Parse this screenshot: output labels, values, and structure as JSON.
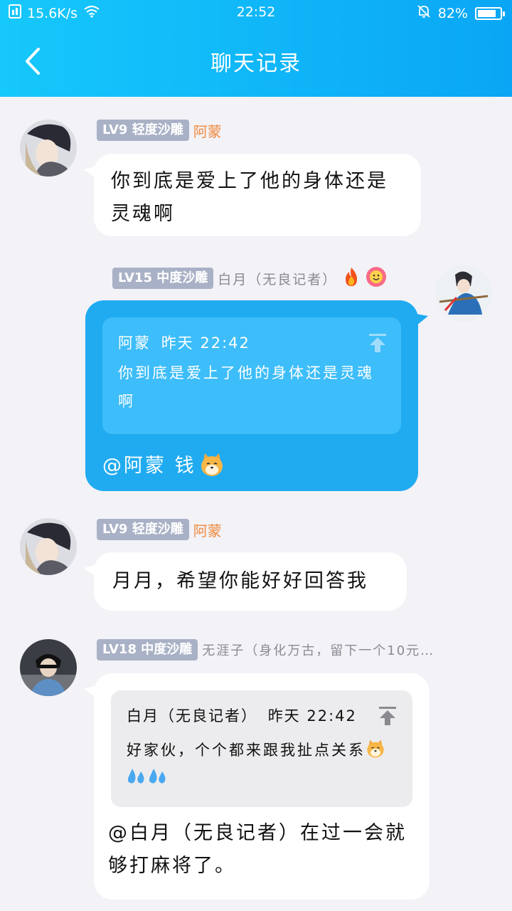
{
  "status_bar": {
    "net_speed": "15.6K/s",
    "time": "22:52",
    "battery": "82%",
    "battery_level": 0.82
  },
  "header": {
    "title": "聊天记录"
  },
  "messages": [
    {
      "level": "LV9 轻度沙雕",
      "sender": "阿蒙",
      "text": "你到底是爱上了他的身体还是灵魂啊"
    },
    {
      "level": "LV15 中度沙雕",
      "sender": "白月（无良记者）",
      "quote": {
        "author": "阿蒙",
        "time": "昨天 22:42",
        "text": "你到底是爱上了他的身体还是灵魂啊"
      },
      "text": "@阿蒙 钱"
    },
    {
      "level": "LV9 轻度沙雕",
      "sender": "阿蒙",
      "text": "月月，希望你能好好回答我"
    },
    {
      "level": "LV18 中度沙雕",
      "sender": "无涯子（身化万古，留下一个10元…",
      "quote": {
        "author": "白月（无良记者）",
        "time": "昨天 22:42",
        "text": "好家伙，个个都来跟我扯点关系"
      },
      "text": "@白月（无良记者）在过一会就够打麻将了。"
    }
  ],
  "colors": {
    "header_start": "#16c8fb",
    "header_end": "#0aa6f5",
    "bubble_blue": "#20abf1",
    "badge": "#a9b1c6"
  },
  "icons": [
    "sim-icon",
    "wifi-icon",
    "mute-bell-icon",
    "battery-icon",
    "back-arrow-icon",
    "fire-icon",
    "flower-face-icon",
    "dog-emoji-icon",
    "sweat-drops-icon",
    "pin-top-icon"
  ]
}
